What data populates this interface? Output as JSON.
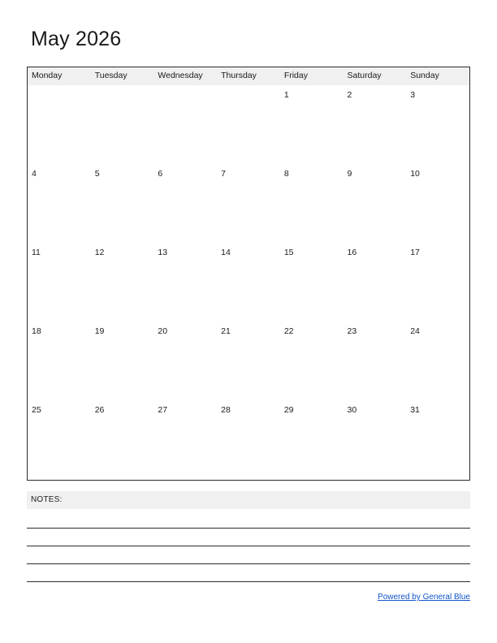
{
  "calendar": {
    "title": "May 2026",
    "month": "May",
    "year": "2026",
    "weekdays": [
      "Monday",
      "Tuesday",
      "Wednesday",
      "Thursday",
      "Friday",
      "Saturday",
      "Sunday"
    ],
    "weeks": [
      [
        "",
        "",
        "",
        "",
        "1",
        "2",
        "3"
      ],
      [
        "4",
        "5",
        "6",
        "7",
        "8",
        "9",
        "10"
      ],
      [
        "11",
        "12",
        "13",
        "14",
        "15",
        "16",
        "17"
      ],
      [
        "18",
        "19",
        "20",
        "21",
        "22",
        "23",
        "24"
      ],
      [
        "25",
        "26",
        "27",
        "28",
        "29",
        "30",
        "31"
      ]
    ]
  },
  "notes": {
    "label": "NOTES:",
    "line_count": 4
  },
  "footer": {
    "link_text": "Powered by General Blue"
  },
  "colors": {
    "header_background": "#f0f0f0",
    "grid_border": "#2b2b2b",
    "text": "#1a1a1a",
    "link": "#1155cc",
    "page_background": "#ffffff"
  }
}
